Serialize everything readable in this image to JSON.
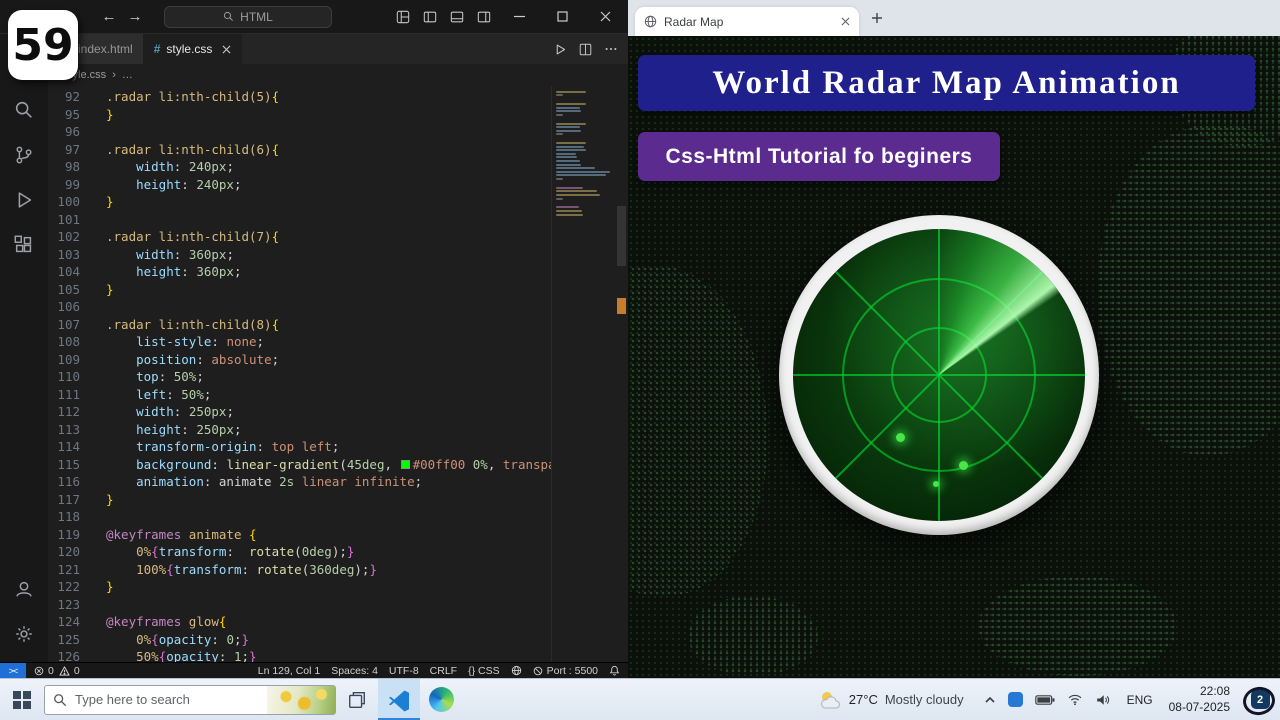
{
  "badge": {
    "number": "59"
  },
  "vscode": {
    "titlebar": {
      "search_text": "HTML"
    },
    "tabs": [
      {
        "label": "index.html"
      },
      {
        "label": "style.css"
      }
    ],
    "breadcrumb": {
      "file": "style.css",
      "sep": "›",
      "more": "…"
    },
    "editor": {
      "lines": [
        {
          "n": "92",
          "t": [
            [
              "sel",
              ".radar li:nth-child(5)"
            ],
            [
              "brc",
              "{"
            ]
          ]
        },
        {
          "n": "95",
          "t": [
            [
              "brc",
              "}"
            ]
          ]
        },
        {
          "n": "96",
          "t": []
        },
        {
          "n": "97",
          "t": [
            [
              "sel",
              ".radar li:nth-child(6)"
            ],
            [
              "brc",
              "{"
            ]
          ]
        },
        {
          "n": "98",
          "t": [
            [
              "pun",
              "    "
            ],
            [
              "prop",
              "width"
            ],
            [
              "pun",
              ": "
            ],
            [
              "num",
              "240px"
            ],
            [
              "pun",
              ";"
            ]
          ]
        },
        {
          "n": "99",
          "t": [
            [
              "pun",
              "    "
            ],
            [
              "prop",
              "height"
            ],
            [
              "pun",
              ": "
            ],
            [
              "num",
              "240px"
            ],
            [
              "pun",
              ";"
            ]
          ]
        },
        {
          "n": "100",
          "t": [
            [
              "brc",
              "}"
            ]
          ]
        },
        {
          "n": "101",
          "t": []
        },
        {
          "n": "102",
          "t": [
            [
              "sel",
              ".radar li:nth-child(7)"
            ],
            [
              "brc",
              "{"
            ]
          ]
        },
        {
          "n": "103",
          "t": [
            [
              "pun",
              "    "
            ],
            [
              "prop",
              "width"
            ],
            [
              "pun",
              ": "
            ],
            [
              "num",
              "360px"
            ],
            [
              "pun",
              ";"
            ]
          ]
        },
        {
          "n": "104",
          "t": [
            [
              "pun",
              "    "
            ],
            [
              "prop",
              "height"
            ],
            [
              "pun",
              ": "
            ],
            [
              "num",
              "360px"
            ],
            [
              "pun",
              ";"
            ]
          ]
        },
        {
          "n": "105",
          "t": [
            [
              "brc",
              "}"
            ]
          ]
        },
        {
          "n": "106",
          "t": []
        },
        {
          "n": "107",
          "t": [
            [
              "sel",
              ".radar li:nth-child(8)"
            ],
            [
              "brc",
              "{"
            ]
          ]
        },
        {
          "n": "108",
          "t": [
            [
              "pun",
              "    "
            ],
            [
              "prop",
              "list-style"
            ],
            [
              "pun",
              ": "
            ],
            [
              "val",
              "none"
            ],
            [
              "pun",
              ";"
            ]
          ]
        },
        {
          "n": "109",
          "t": [
            [
              "pun",
              "    "
            ],
            [
              "prop",
              "position"
            ],
            [
              "pun",
              ": "
            ],
            [
              "val",
              "absolute"
            ],
            [
              "pun",
              ";"
            ]
          ]
        },
        {
          "n": "110",
          "t": [
            [
              "pun",
              "    "
            ],
            [
              "prop",
              "top"
            ],
            [
              "pun",
              ": "
            ],
            [
              "num",
              "50%"
            ],
            [
              "pun",
              ";"
            ]
          ]
        },
        {
          "n": "111",
          "t": [
            [
              "pun",
              "    "
            ],
            [
              "prop",
              "left"
            ],
            [
              "pun",
              ": "
            ],
            [
              "num",
              "50%"
            ],
            [
              "pun",
              ";"
            ]
          ]
        },
        {
          "n": "112",
          "t": [
            [
              "pun",
              "    "
            ],
            [
              "prop",
              "width"
            ],
            [
              "pun",
              ": "
            ],
            [
              "num",
              "250px"
            ],
            [
              "pun",
              ";"
            ]
          ]
        },
        {
          "n": "113",
          "t": [
            [
              "pun",
              "    "
            ],
            [
              "prop",
              "height"
            ],
            [
              "pun",
              ": "
            ],
            [
              "num",
              "250px"
            ],
            [
              "pun",
              ";"
            ]
          ]
        },
        {
          "n": "114",
          "t": [
            [
              "pun",
              "    "
            ],
            [
              "prop",
              "transform-origin"
            ],
            [
              "pun",
              ": "
            ],
            [
              "val",
              "top left"
            ],
            [
              "pun",
              ";"
            ]
          ]
        },
        {
          "n": "115",
          "t": [
            [
              "pun",
              "    "
            ],
            [
              "prop",
              "background"
            ],
            [
              "pun",
              ": "
            ],
            [
              "fn",
              "linear-gradient"
            ],
            [
              "pun",
              "("
            ],
            [
              "num",
              "45deg"
            ],
            [
              "pun",
              ", "
            ],
            [
              "swatch",
              ""
            ],
            [
              "val",
              "#00ff00"
            ],
            [
              "pun",
              " "
            ],
            [
              "num",
              "0%"
            ],
            [
              "pun",
              ", "
            ],
            [
              "val",
              "transparent"
            ]
          ]
        },
        {
          "n": "116",
          "t": [
            [
              "pun",
              "    "
            ],
            [
              "prop",
              "animation"
            ],
            [
              "pun",
              ": "
            ],
            [
              "pun",
              "animate "
            ],
            [
              "num",
              "2s"
            ],
            [
              "val",
              " linear infinite"
            ],
            [
              "pun",
              ";"
            ]
          ]
        },
        {
          "n": "117",
          "t": [
            [
              "brc",
              "}"
            ]
          ]
        },
        {
          "n": "118",
          "t": []
        },
        {
          "n": "119",
          "t": [
            [
              "at",
              "@keyframes"
            ],
            [
              "pun",
              " "
            ],
            [
              "sel",
              "animate"
            ],
            [
              "pun",
              " "
            ],
            [
              "brc",
              "{"
            ]
          ]
        },
        {
          "n": "120",
          "t": [
            [
              "pun",
              "    "
            ],
            [
              "sel",
              "0%"
            ],
            [
              "brc2",
              "{"
            ],
            [
              "prop",
              "transform"
            ],
            [
              "pun",
              ":  "
            ],
            [
              "fn",
              "rotate"
            ],
            [
              "pun",
              "("
            ],
            [
              "num",
              "0deg"
            ],
            [
              "pun",
              ");"
            ],
            [
              "brc2",
              "}"
            ]
          ]
        },
        {
          "n": "121",
          "t": [
            [
              "pun",
              "    "
            ],
            [
              "sel",
              "100%"
            ],
            [
              "brc2",
              "{"
            ],
            [
              "prop",
              "transform"
            ],
            [
              "pun",
              ": "
            ],
            [
              "fn",
              "rotate"
            ],
            [
              "pun",
              "("
            ],
            [
              "num",
              "360deg"
            ],
            [
              "pun",
              ");"
            ],
            [
              "brc2",
              "}"
            ]
          ]
        },
        {
          "n": "122",
          "t": [
            [
              "brc",
              "}"
            ]
          ]
        },
        {
          "n": "123",
          "t": []
        },
        {
          "n": "124",
          "t": [
            [
              "at",
              "@keyframes"
            ],
            [
              "pun",
              " "
            ],
            [
              "sel",
              "glow"
            ],
            [
              "brc",
              "{"
            ]
          ]
        },
        {
          "n": "125",
          "t": [
            [
              "pun",
              "    "
            ],
            [
              "sel",
              "0%"
            ],
            [
              "brc2",
              "{"
            ],
            [
              "prop",
              "opacity"
            ],
            [
              "pun",
              ": "
            ],
            [
              "num",
              "0"
            ],
            [
              "pun",
              ";"
            ],
            [
              "brc2",
              "}"
            ]
          ]
        },
        {
          "n": "126",
          "t": [
            [
              "pun",
              "    "
            ],
            [
              "sel",
              "50%"
            ],
            [
              "brc2",
              "{"
            ],
            [
              "prop",
              "opacity"
            ],
            [
              "pun",
              ": "
            ],
            [
              "num",
              "1"
            ],
            [
              "pun",
              ";"
            ],
            [
              "brc2",
              "}"
            ]
          ]
        }
      ]
    },
    "status": {
      "remote": "><",
      "errors": "0",
      "warnings": "0",
      "ln_col": "Ln 129, Col 1",
      "spaces": "Spaces: 4",
      "encoding": "UTF-8",
      "eol": "CRLF",
      "lang": "{} CSS",
      "port": "Port : 5500"
    }
  },
  "browser": {
    "tab": {
      "title": "Radar Map"
    },
    "page": {
      "title": "World  Radar Map Animation",
      "subtitle": "Css-Html  Tutorial fo beginers"
    }
  },
  "taskbar": {
    "search_placeholder": "Type here to search",
    "weather_temp": "27°C",
    "weather_desc": "Mostly cloudy",
    "lang": "ENG",
    "time": "22:08",
    "date": "08-07-2025",
    "notification_count": "2"
  },
  "colors": {
    "accent_green": "#00ff00",
    "banner_blue": "#20208c",
    "banner_purple": "#5c2b8f"
  }
}
